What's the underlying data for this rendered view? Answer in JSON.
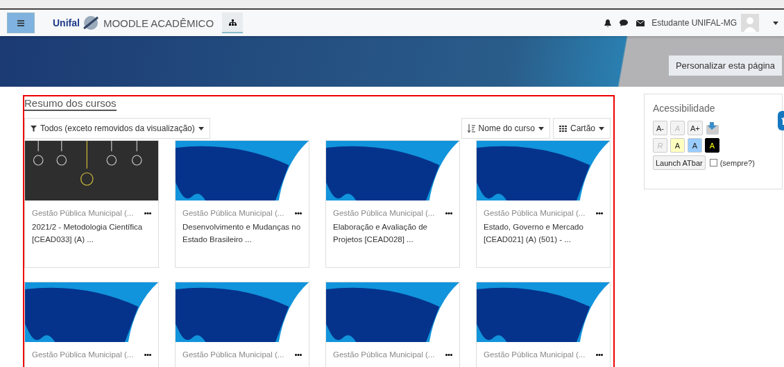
{
  "navbar": {
    "logo_text": "Unifal",
    "site_name": "MOODLE ACADÊMICO",
    "user_name": "Estudante UNIFAL-MG"
  },
  "header": {
    "customize_button": "Personalizar esta página"
  },
  "course_overview": {
    "title": "Resumo dos cursos",
    "filter": "Todos (exceto removidos da visualização)",
    "sort": "Nome do curso",
    "view": "Cartão",
    "courses": [
      {
        "kind": "bulbs",
        "category": "Gestão Pública Municipal (...",
        "name": "2021/2 - Metodologia Científica [CEAD033] (A) ..."
      },
      {
        "kind": "pattern",
        "category": "Gestão Pública Municipal (...",
        "name": "Desenvolvimento e Mudanças no Estado Brasileiro ..."
      },
      {
        "kind": "pattern",
        "category": "Gestão Pública Municipal (...",
        "name": "Elaboração e Avaliação de Projetos [CEAD028] ..."
      },
      {
        "kind": "pattern",
        "category": "Gestão Pública Municipal (...",
        "name": "Estado, Governo e Mercado [CEAD021] (A) (501) - ..."
      },
      {
        "kind": "pattern",
        "category": "Gestão Pública Municipal (..."
      },
      {
        "kind": "pattern",
        "category": "Gestão Pública Municipal (..."
      },
      {
        "kind": "pattern",
        "category": "Gestão Pública Municipal (..."
      },
      {
        "kind": "pattern",
        "category": "Gestão Pública Municipal (..."
      }
    ]
  },
  "accessibility": {
    "title": "Acessibilidade",
    "font_buttons": [
      {
        "label": "A-",
        "disabled": false
      },
      {
        "label": "A",
        "disabled": true
      },
      {
        "label": "A+",
        "disabled": false
      }
    ],
    "color_buttons": [
      {
        "label": "R",
        "kind": "reset",
        "disabled": true
      },
      {
        "label": "A",
        "kind": "yellow",
        "disabled": false
      },
      {
        "label": "A",
        "kind": "blue",
        "disabled": false
      },
      {
        "label": "A",
        "kind": "black",
        "disabled": false
      }
    ],
    "launch_button": "Launch ATbar",
    "always_label": "(sempre?)",
    "always_checked": false
  }
}
